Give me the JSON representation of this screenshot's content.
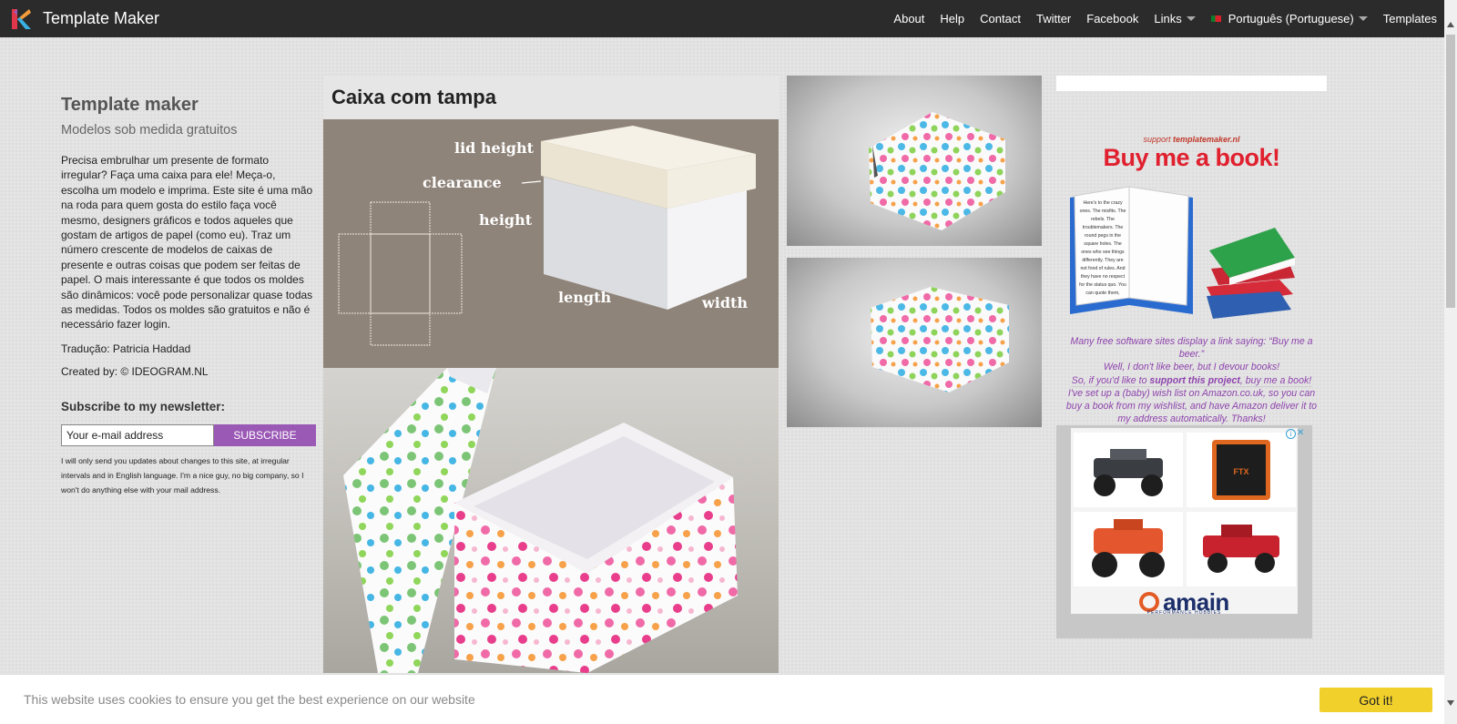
{
  "brand": {
    "name": "Template Maker",
    "logo_icon": "template-maker-logo-icon"
  },
  "nav": {
    "about": "About",
    "help": "Help",
    "contact": "Contact",
    "twitter": "Twitter",
    "facebook": "Facebook",
    "links": "Links",
    "language": "Português (Portuguese)",
    "templates": "Templates"
  },
  "sidebar": {
    "title": "Template maker",
    "subtitle": "Modelos sob medida gratuitos",
    "intro": "Precisa embrulhar um presente de formato irregular? Faça uma caixa para ele! Meça-o, escolha um modelo e imprima. Este site é uma mão na roda para quem gosta do estilo faça você mesmo, designers gráficos e todos aqueles que gostam de artigos de papel (como eu). Traz um número crescente de modelos de caixas de presente e outras coisas que podem ser feitas de papel. O mais interessante é que todos os moldes são dinâmicos: você pode personalizar quase todas as medidas. Todos os moldes são gratuitos e não é necessário fazer login.",
    "translation": "Tradução: Patricia Haddad",
    "created_by": "Created by: © IDEOGRAM.NL",
    "newsletter_title": "Subscribe to my newsletter:",
    "email_placeholder": "Your e-mail address",
    "subscribe_label": "SUBSCRIBE",
    "disclaimer": "I will only send you updates about changes to this site, at irregular intervals and in English language. I'm a nice guy, no big company, so I won't do anything else with your mail address."
  },
  "main": {
    "title": "Caixa com tampa",
    "diagram_labels": {
      "lid_height": "lid height",
      "clearance": "clearance",
      "height": "height",
      "length": "length",
      "width": "width"
    }
  },
  "promo": {
    "support_prefix": "support",
    "support_site": "templatemaker.nl",
    "headline": "Buy me a book!",
    "book_text": "Here's to the crazy ones. The misfits. The rebels. The troublemakers. The round pegs in the square holes. The ones who see things differently. They are not fond of rules. And they have no respect for the status quo. You can quote them, disagree with them, glorify or vilify them. About the only thing you can't do is",
    "line1": "Many free software sites display a link saying: “Buy me a beer.”",
    "line2": "Well, I don't like beer, but I devour books!",
    "line3_pre": "So, if you'd like to",
    "line3_bold": "support this project",
    "line3_post": ", buy me a book!",
    "line4": "I've set up a (baby) wish list on Amazon.co.uk, so you can buy a book from my wishlist, and have Amazon deliver it to my address automatically. Thanks!"
  },
  "ad": {
    "brand": "amain",
    "tagline": "PERFORMANCE HOBBIES",
    "info_icon": "i",
    "close_icon": "✕",
    "product_brand": "FTX"
  },
  "cookie": {
    "message": "This website uses cookies to ensure you get the best experience on our website",
    "button": "Got it!"
  },
  "colors": {
    "navbar": "#2b2b2b",
    "subscribe": "#9b59b6",
    "promo_headline": "#e0202e",
    "promo_text": "#8e44ad",
    "cookie_button": "#f1d02b"
  }
}
